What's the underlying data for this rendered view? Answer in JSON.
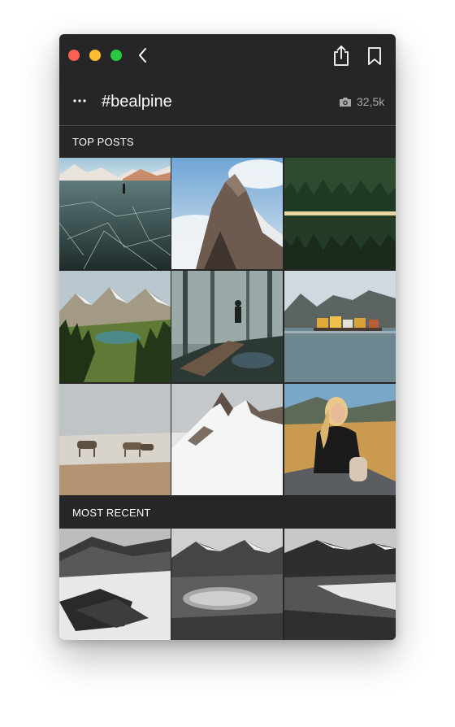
{
  "window": {
    "hashtag": "#bealpine",
    "post_count": "32,5k"
  },
  "icons": {
    "close": "close-window-button",
    "minimize": "minimize-window-button",
    "maximize": "maximize-window-button",
    "back": "chevron-left-icon",
    "share": "share-icon",
    "bookmark": "bookmark-icon",
    "more": "more-horizontal-icon",
    "camera": "camera-icon"
  },
  "sections": {
    "top_posts": {
      "label": "TOP POSTS",
      "items": [
        {
          "name": "frozen-lake-skater"
        },
        {
          "name": "misty-rock-peak"
        },
        {
          "name": "forest-lake-reflection"
        },
        {
          "name": "alpine-valley-lake"
        },
        {
          "name": "forest-hiker-boardwalk"
        },
        {
          "name": "fjord-village-houses"
        },
        {
          "name": "reindeer-snow-plain"
        },
        {
          "name": "snowy-mountain-ridge"
        },
        {
          "name": "woman-black-turtleneck"
        }
      ]
    },
    "most_recent": {
      "label": "MOST RECENT",
      "items": [
        {
          "name": "bw-snow-hills"
        },
        {
          "name": "bw-mountain-pond"
        },
        {
          "name": "bw-snow-slope"
        }
      ]
    }
  },
  "colors": {
    "window_bg": "#262626",
    "text_primary": "#ffffff",
    "text_secondary": "#a9a9a9",
    "close": "#fd5f57",
    "minimize": "#febc2e",
    "maximize": "#28c840"
  }
}
